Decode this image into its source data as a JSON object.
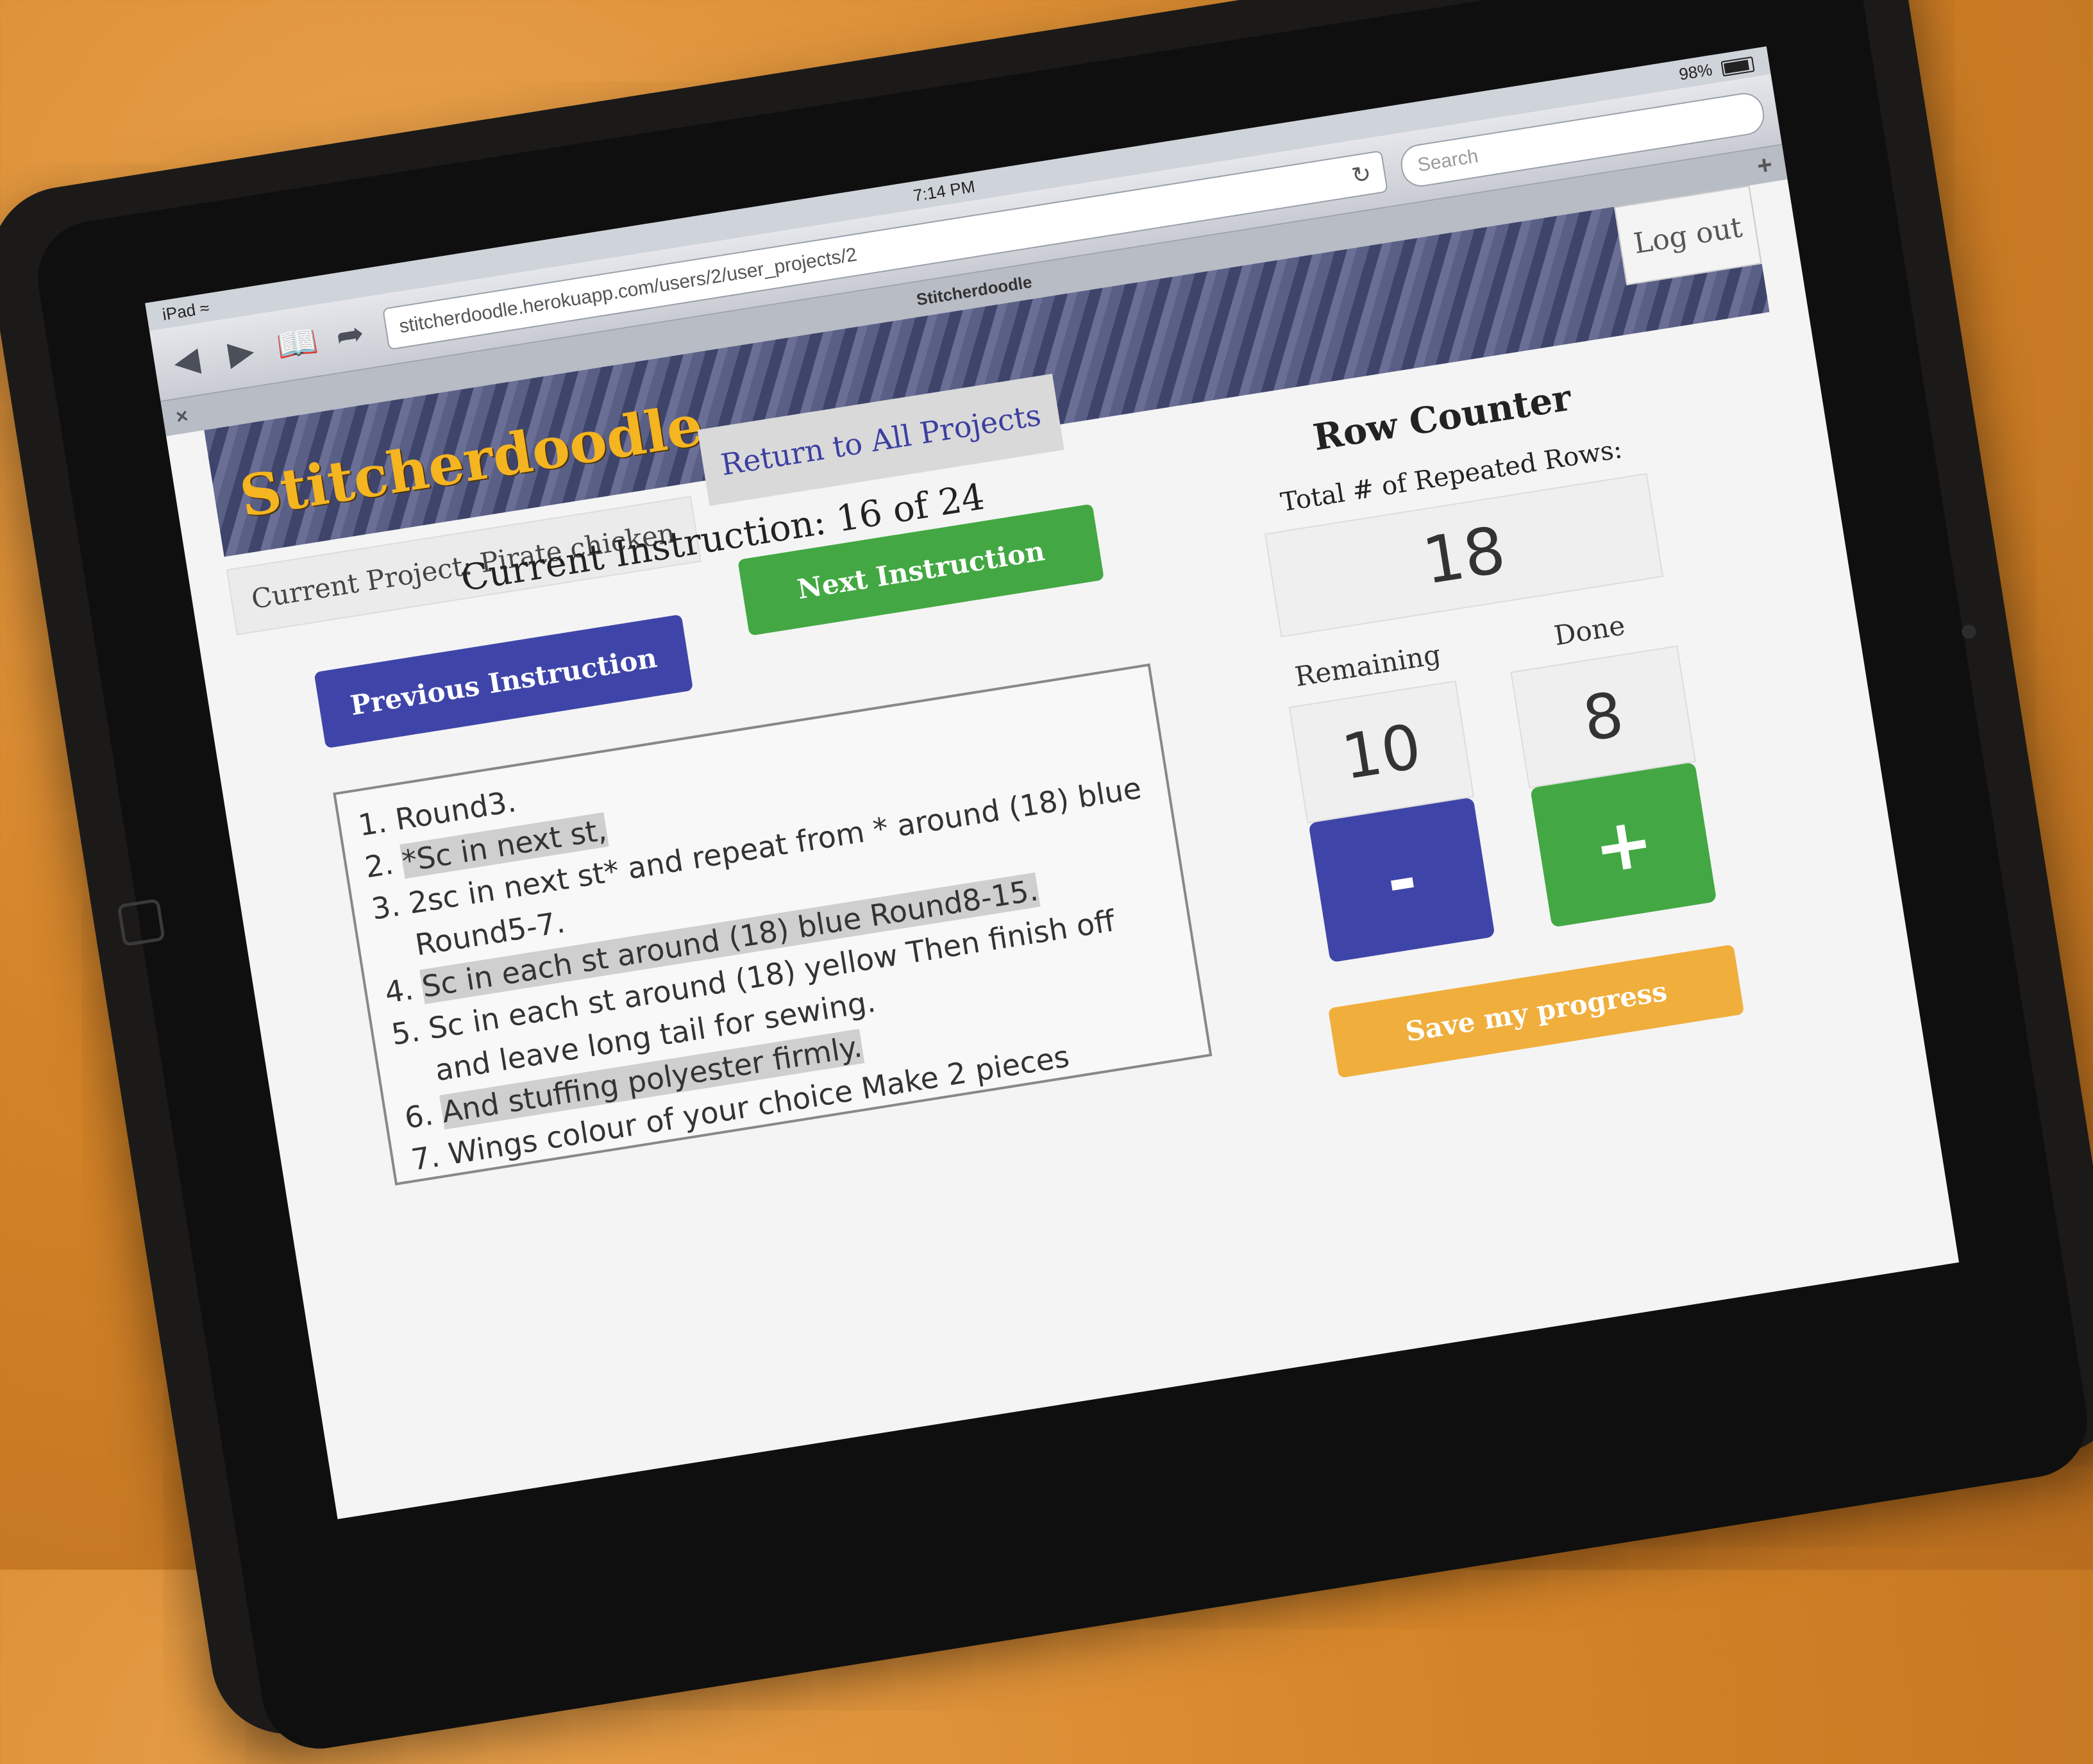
{
  "status": {
    "device": "iPad",
    "wifi_icon": "wifi-icon",
    "time": "7:14 PM",
    "battery": "98%"
  },
  "browser": {
    "url": "stitcherdoodle.herokuapp.com/users/2/user_projects/2",
    "search_placeholder": "Search",
    "tab_title": "Stitcherdoodle"
  },
  "header": {
    "logo": "Stitcherdoodle",
    "logout_label": "Log out"
  },
  "project": {
    "current": "Current Project: Pirate chicken",
    "return_label": "Return to All Projects"
  },
  "instruction": {
    "heading": "Current Instruction: 16 of 24",
    "prev_label": "Previous Instruction",
    "next_label": "Next Instruction",
    "items": [
      "Round3.",
      "*Sc in next st,",
      "2sc in next st* and repeat from * around (18) blue Round5-7.",
      "Sc in each st around (18) blue Round8-15.",
      "Sc in each st around (18) yellow Then finish off and leave long tail for sewing.",
      "And stuffing polyester firmly.",
      "Wings colour of your choice Make 2 pieces"
    ]
  },
  "counter": {
    "title": "Row Counter",
    "total_label": "Total # of Repeated Rows:",
    "total": "18",
    "remaining_label": "Remaining",
    "remaining": "10",
    "done_label": "Done",
    "done": "8",
    "minus_label": "-",
    "plus_label": "+",
    "save_label": "Save my progress"
  },
  "colors": {
    "logo": "#f5b521",
    "prev": "#3f45a8",
    "next": "#43a843",
    "save": "#f0ae3c"
  }
}
